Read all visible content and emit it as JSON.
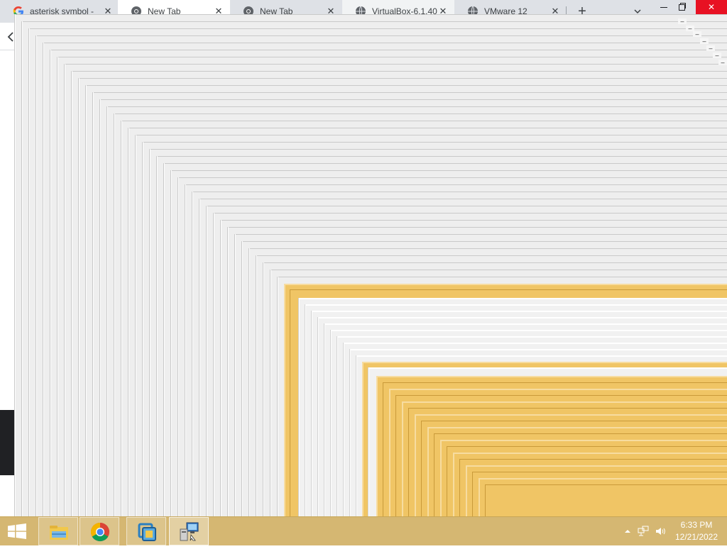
{
  "browser": {
    "tabs": [
      {
        "title": "asterisk symbol -",
        "icon": "google-icon",
        "active": false
      },
      {
        "title": "New Tab",
        "icon": "chrome-icon",
        "active": true
      },
      {
        "title": "New Tab",
        "icon": "chrome-icon",
        "active": false
      },
      {
        "title": "VirtualBox-6.1.40",
        "icon": "globe-icon",
        "active": false
      },
      {
        "title": "VMware 12",
        "icon": "globe-icon",
        "active": false
      }
    ],
    "new_tab_icon": "plus-icon",
    "tab_search_icon": "chevron-down-icon"
  },
  "window_controls": {
    "minimize_icon": "minimize-icon",
    "maximize_icon": "restore-icon",
    "close_icon": "close-icon"
  },
  "taskbar": {
    "start_icon": "windows-start-icon",
    "pinned": [
      {
        "name": "file-explorer-icon"
      },
      {
        "name": "chrome-icon"
      },
      {
        "name": "vmware-icon"
      },
      {
        "name": "network-setup-icon",
        "running": true
      }
    ],
    "clock": {
      "time": "6:33 PM",
      "date": "12/21/2022"
    },
    "tray_icons": [
      "show-hidden-icons-arrow",
      "network-icon",
      "volume-icon"
    ]
  },
  "colors": {
    "taskbar": "#d5b772",
    "trail_gray": "#eeeeee",
    "trail_gold": "#f0c565",
    "close_red": "#e81123"
  }
}
